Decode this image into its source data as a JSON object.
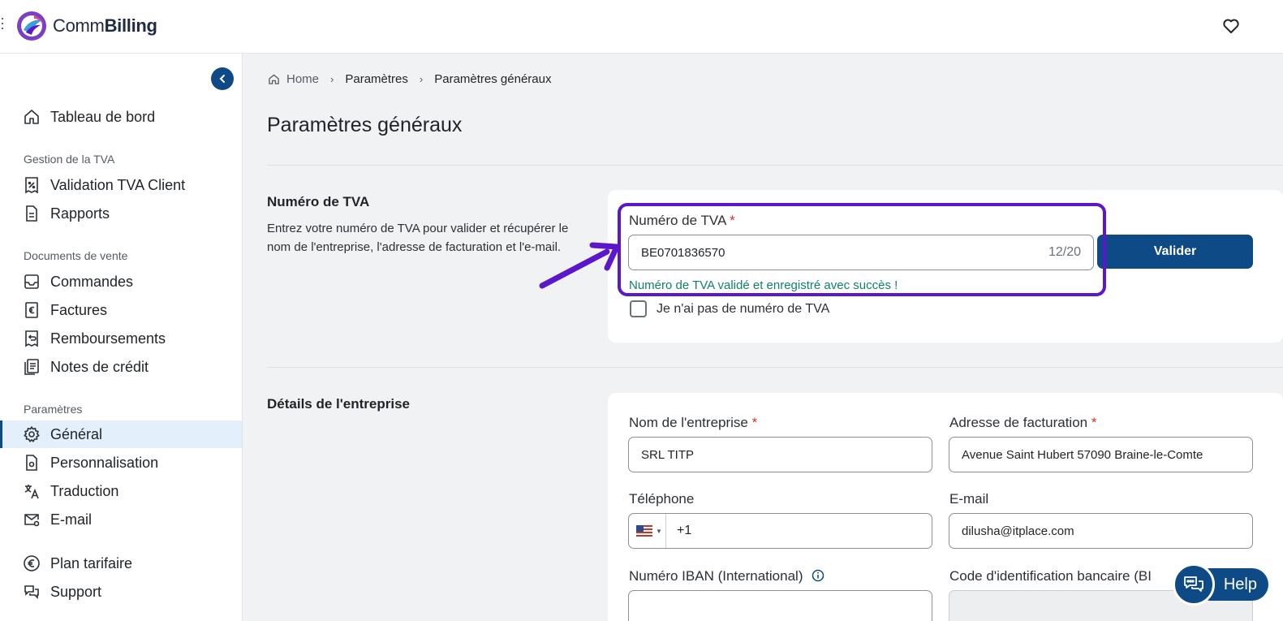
{
  "app": {
    "brand_light": "Comm",
    "brand_bold": "Billing"
  },
  "colors": {
    "primary": "#0e4a86",
    "highlight": "#5b17c9",
    "success": "#12806b",
    "required": "#d32f2f"
  },
  "sidebar": {
    "dashboard": "Tableau de bord",
    "sections": {
      "tva": "Gestion de la TVA",
      "sales": "Documents de vente",
      "settings": "Paramètres"
    },
    "items": {
      "tva_validation": "Validation TVA Client",
      "reports": "Rapports",
      "orders": "Commandes",
      "invoices": "Factures",
      "refunds": "Remboursements",
      "credit_notes": "Notes de crédit",
      "general": "Général",
      "customization": "Personnalisation",
      "translation": "Traduction",
      "email": "E-mail",
      "pricing": "Plan tarifaire",
      "support": "Support"
    }
  },
  "breadcrumb": {
    "home": "Home",
    "level1": "Paramètres",
    "level2": "Paramètres généraux"
  },
  "page": {
    "title": "Paramètres généraux"
  },
  "vat_section": {
    "title": "Numéro de TVA",
    "description": "Entrez votre numéro de TVA pour valider et récupérer le nom de l'entreprise, l'adresse de facturation et l'e-mail.",
    "field_label": "Numéro de TVA",
    "required_mark": "*",
    "value": "BE0701836570",
    "counter": "12/20",
    "validate_button": "Valider",
    "success_message": "Numéro de TVA validé et enregistré avec succès !",
    "no_vat_checkbox": "Je n'ai pas de numéro de TVA"
  },
  "company_section": {
    "title": "Détails de l'entreprise",
    "company_name_label": "Nom de l'entreprise",
    "company_name_value": "SRL TITP",
    "billing_address_label": "Adresse de facturation",
    "billing_address_value": "Avenue Saint Hubert 57090 Braine-le-Comte",
    "phone_label": "Téléphone",
    "phone_country": "us-flag-icon",
    "phone_value": "+1",
    "email_label": "E-mail",
    "email_value": "dilusha@itplace.com",
    "iban_label": "Numéro IBAN (International)",
    "bic_label": "Code d'identification bancaire (BI",
    "required_mark": "*"
  },
  "help": {
    "label": "Help"
  }
}
